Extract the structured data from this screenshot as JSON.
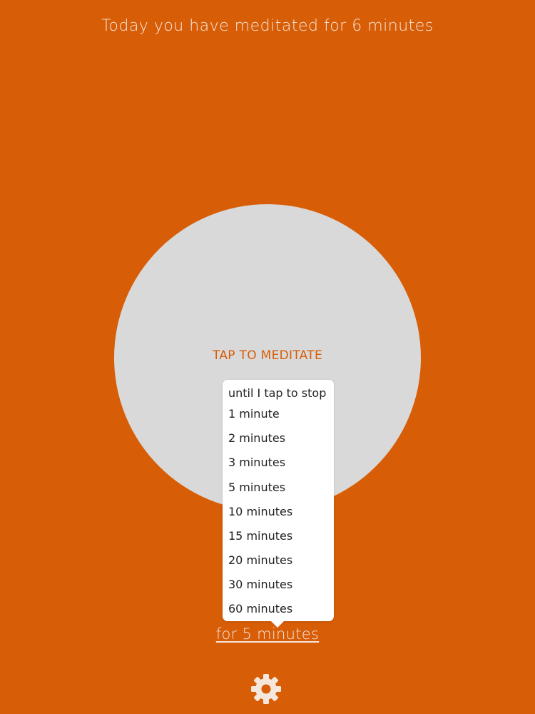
{
  "colors": {
    "background": "#d75d07",
    "circle": "#d9d9d9",
    "accent": "#d75d07",
    "menu_background": "#ffffff",
    "menu_text": "#222222",
    "light_text": "#f6e7dc"
  },
  "header": {
    "today_text": "Today you have meditated for 6 minutes"
  },
  "meditate": {
    "tap_label": "TAP TO MEDITATE"
  },
  "duration_menu": {
    "items": [
      "until I tap to stop",
      "1 minute",
      "2 minutes",
      "3 minutes",
      "5 minutes",
      "10 minutes",
      "15 minutes",
      "20 minutes",
      "30 minutes",
      "60 minutes"
    ]
  },
  "footer": {
    "duration_label": "for 5 minutes",
    "settings_icon": "gear-icon"
  }
}
